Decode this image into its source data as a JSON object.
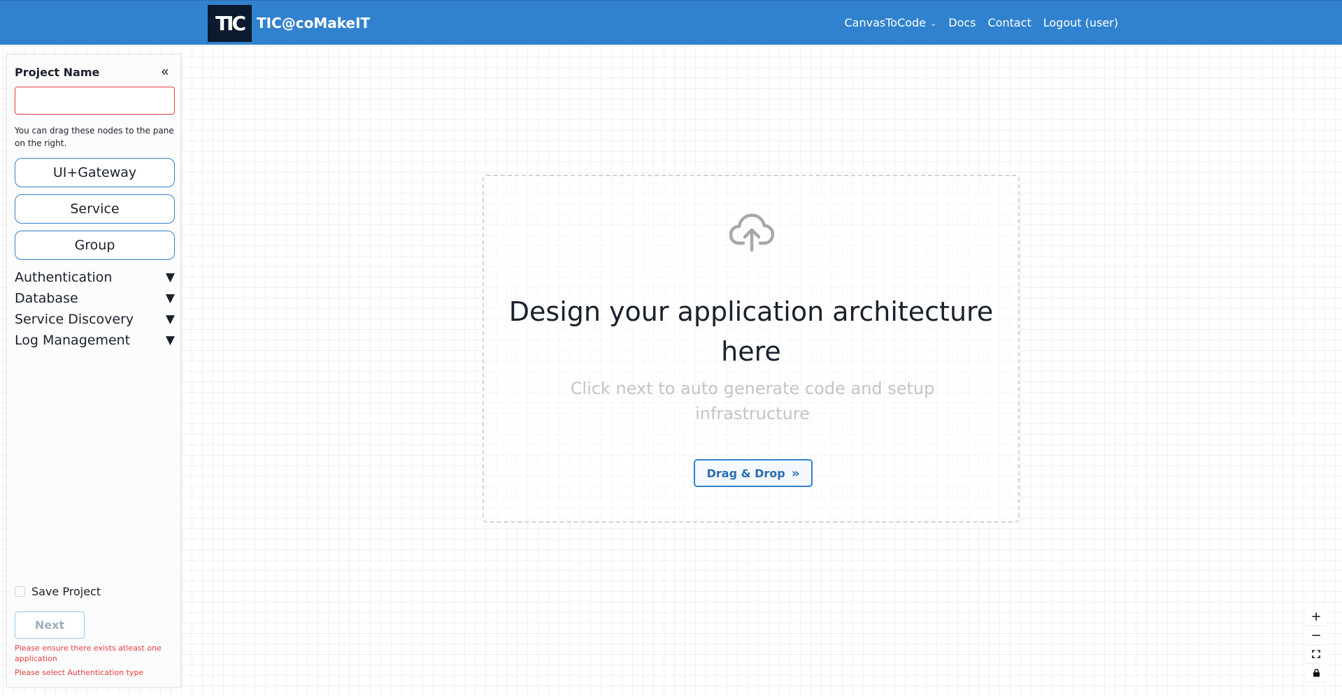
{
  "header": {
    "logo_text": "TIC",
    "brand": "TIC@coMakeIT",
    "nav": {
      "canvas_to_code": "CanvasToCode",
      "docs": "Docs",
      "contact": "Contact",
      "logout": "Logout (user)"
    },
    "bg_color": "#3182ce"
  },
  "sidebar": {
    "project_name_label": "Project Name",
    "project_name_value": "",
    "hint": "You can drag these nodes to the pane on the right.",
    "nodes": [
      {
        "label": "UI+Gateway"
      },
      {
        "label": "Service"
      },
      {
        "label": "Group"
      }
    ],
    "sections": [
      {
        "label": "Authentication"
      },
      {
        "label": "Database"
      },
      {
        "label": "Service Discovery"
      },
      {
        "label": "Log Management"
      }
    ],
    "save_project_label": "Save Project",
    "save_project_checked": false,
    "next_label": "Next",
    "errors": [
      "Please ensure there exists atleast one application",
      "Please select Authentication type"
    ]
  },
  "dropzone": {
    "title": "Design your application architecture here",
    "subtitle": "Click next to auto generate code and setup infrastructure",
    "button_label": "Drag & Drop"
  },
  "controls": {
    "zoom_in": "+",
    "zoom_out": "−"
  }
}
